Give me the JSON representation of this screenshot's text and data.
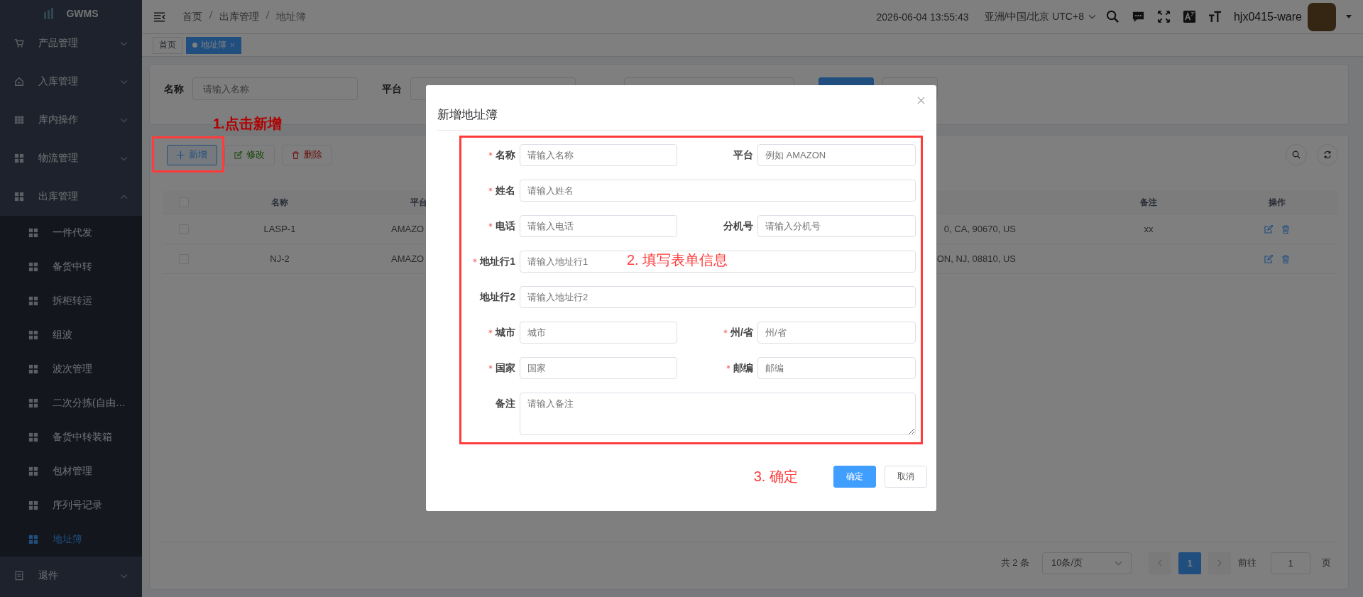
{
  "sidebar": {
    "logo": "GWMS",
    "items": [
      {
        "label": "产品管理",
        "expanded": false
      },
      {
        "label": "入库管理",
        "expanded": false
      },
      {
        "label": "库内操作",
        "expanded": false
      },
      {
        "label": "物流管理",
        "expanded": false
      },
      {
        "label": "出库管理",
        "expanded": true,
        "children": [
          {
            "label": "一件代发",
            "selected": false
          },
          {
            "label": "备货中转",
            "selected": false
          },
          {
            "label": "拆柜转运",
            "selected": false
          },
          {
            "label": "组波",
            "selected": false
          },
          {
            "label": "波次管理",
            "selected": false
          },
          {
            "label": "二次分拣(自由…",
            "selected": false
          },
          {
            "label": "备货中转装箱",
            "selected": false
          },
          {
            "label": "包材管理",
            "selected": false
          },
          {
            "label": "序列号记录",
            "selected": false
          },
          {
            "label": "地址簿",
            "selected": true
          }
        ]
      },
      {
        "label": "退件",
        "expanded": false
      }
    ]
  },
  "header": {
    "breadcrumb": [
      "首页",
      "出库管理",
      "地址簿"
    ],
    "datetime": "2026-06-04 13:55:43",
    "timezone": "亚洲/中国/北京 UTC+8",
    "user": "hjx0415-ware"
  },
  "tags": [
    {
      "label": "首页",
      "selected": false
    },
    {
      "label": "地址簿",
      "selected": true
    }
  ],
  "search": {
    "fields": [
      {
        "label": "名称",
        "placeholder": "请输入名称"
      },
      {
        "label": "平台"
      }
    ]
  },
  "toolbar": {
    "buttons": [
      {
        "label": "新增",
        "kind": "primary",
        "disabled": false
      },
      {
        "label": "修改",
        "kind": "success",
        "disabled": true
      },
      {
        "label": "删除",
        "kind": "danger",
        "disabled": true
      }
    ]
  },
  "table": {
    "all_selected": false,
    "columns": [
      "名称",
      "平台",
      "备注",
      "操作"
    ],
    "rows": [
      {
        "name": "LASP-1",
        "platform": "AMAZO",
        "column_3": "0, CA, 90670, US",
        "remark": "xx",
        "selected": false
      },
      {
        "name": "NJ-2",
        "platform": "AMAZO",
        "column_3": "ON, NJ, 08810, US",
        "remark": "",
        "selected": false
      }
    ]
  },
  "pagination": {
    "total": "共 2 条",
    "page_size": "10条/页",
    "pages": [
      {
        "label": "1",
        "selected": true
      }
    ],
    "goto_label": "前往",
    "goto_value": "1",
    "goto_suffix": "页"
  },
  "annotations": {
    "step_1": "1.点击新增",
    "step_2": "2. 填写表单信息",
    "step_3": "3. 确定"
  },
  "dialog": {
    "title": "新增地址簿",
    "fields": [
      {
        "label": "名称",
        "required": true,
        "placeholder": "请输入名称",
        "kind": "half"
      },
      {
        "label": "平台",
        "required": false,
        "placeholder": "例如 AMAZON",
        "kind": "half"
      },
      {
        "label": "姓名",
        "required": true,
        "placeholder": "请输入姓名",
        "kind": "full"
      },
      {
        "label": "电话",
        "required": true,
        "placeholder": "请输入电话",
        "kind": "half"
      },
      {
        "label": "分机号",
        "required": false,
        "placeholder": "请输入分机号",
        "kind": "half"
      },
      {
        "label": "地址行1",
        "required": true,
        "placeholder": "请输入地址行1",
        "kind": "full"
      },
      {
        "label": "地址行2",
        "required": false,
        "placeholder": "请输入地址行2",
        "kind": "full"
      },
      {
        "label": "城市",
        "required": true,
        "placeholder": "城市",
        "kind": "half"
      },
      {
        "label": "州/省",
        "required": true,
        "placeholder": "州/省",
        "kind": "half"
      },
      {
        "label": "国家",
        "required": true,
        "placeholder": "国家",
        "kind": "half"
      },
      {
        "label": "邮编",
        "required": true,
        "placeholder": "邮编",
        "kind": "half"
      },
      {
        "label": "备注",
        "required": false,
        "placeholder": "请输入备注",
        "kind": "textarea"
      }
    ],
    "buttons": [
      {
        "label": "确定",
        "kind": "primary"
      },
      {
        "label": "取消",
        "kind": "default"
      }
    ]
  }
}
